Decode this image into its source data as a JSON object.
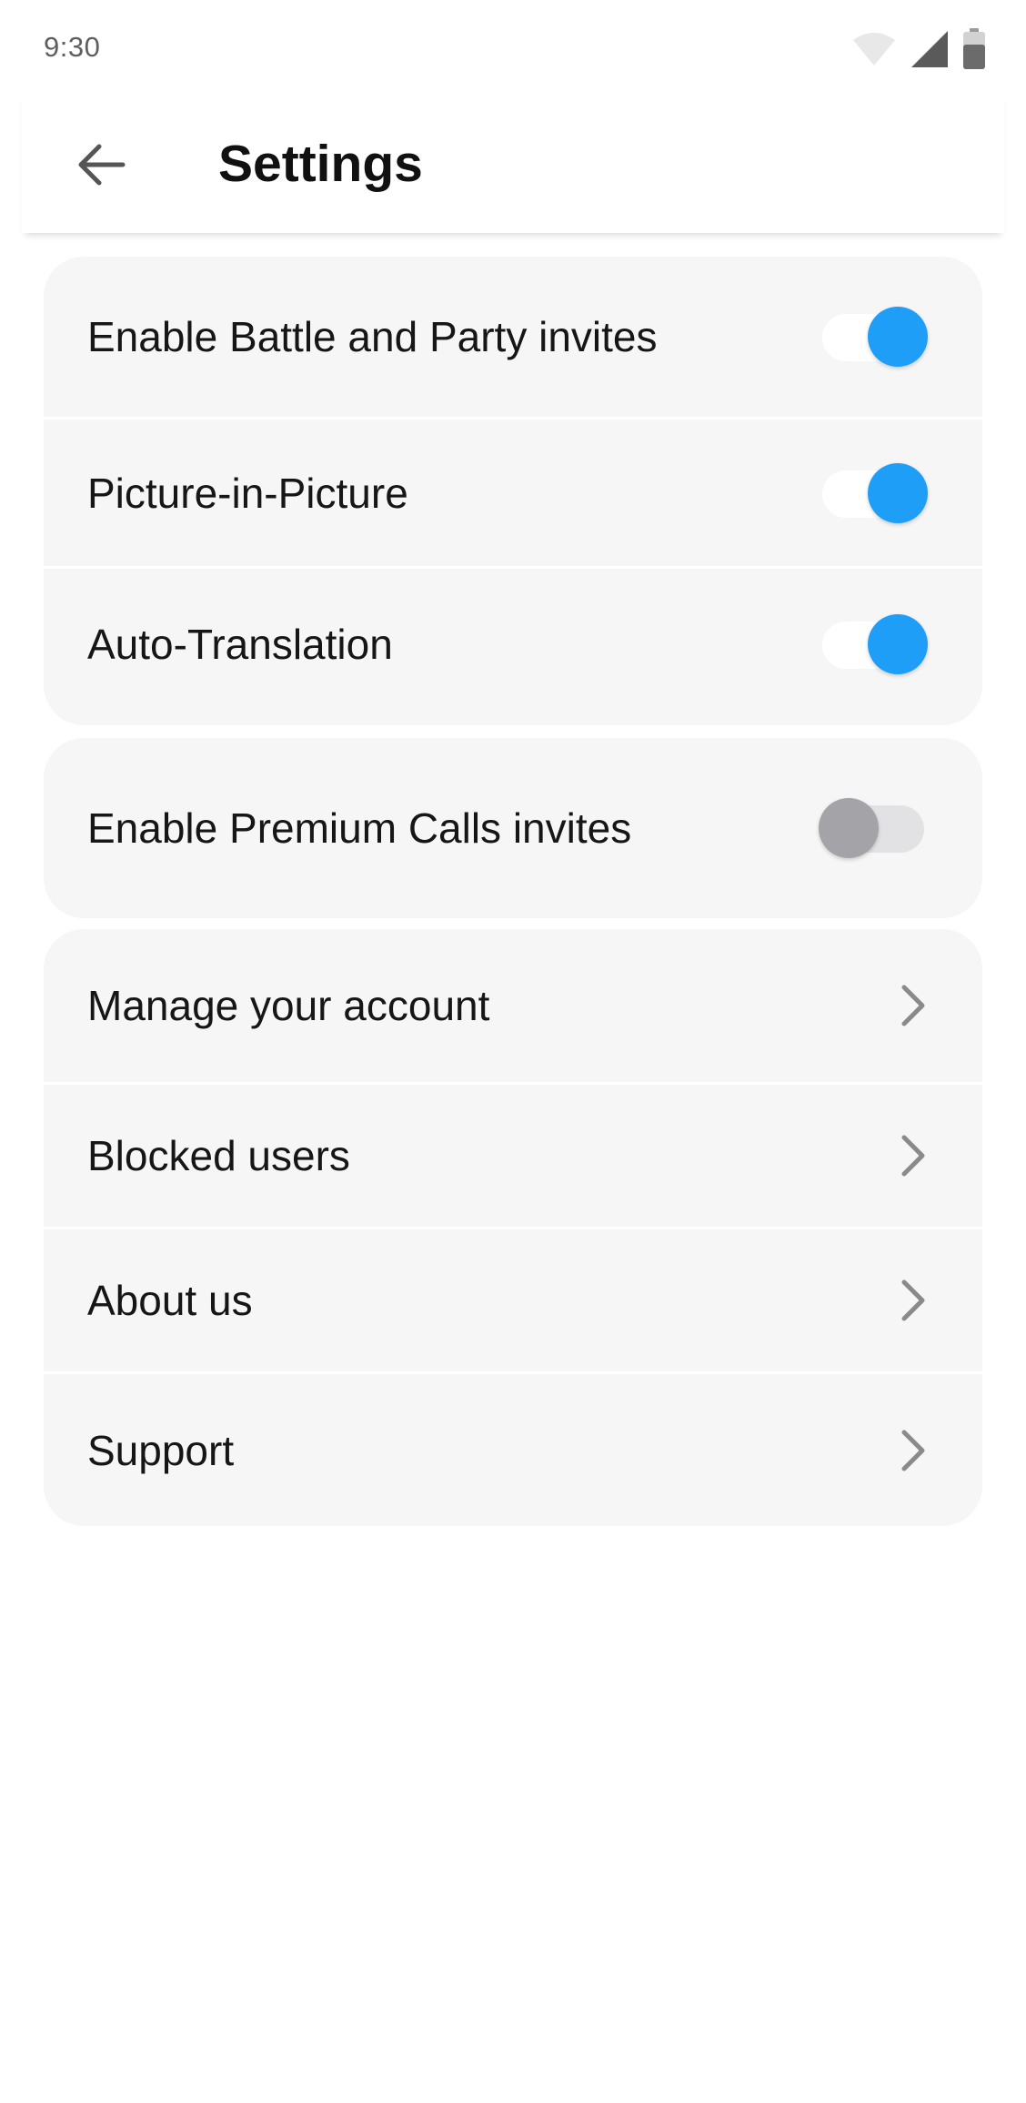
{
  "status_bar": {
    "time": "9:30"
  },
  "header": {
    "title": "Settings",
    "back_icon": "arrow-left-icon"
  },
  "toggle_section": {
    "items": [
      {
        "label": "Enable Battle and Party invites",
        "enabled": true
      },
      {
        "label": "Picture-in-Picture",
        "enabled": true
      },
      {
        "label": "Auto-Translation",
        "enabled": true
      }
    ]
  },
  "premium_section": {
    "items": [
      {
        "label": "Enable Premium Calls invites",
        "enabled": false
      }
    ]
  },
  "nav_section": {
    "items": [
      {
        "label": "Manage your account",
        "icon": "chevron-right-icon"
      },
      {
        "label": "Blocked users",
        "icon": "chevron-right-icon"
      },
      {
        "label": "About us",
        "icon": "chevron-right-icon"
      },
      {
        "label": "Support",
        "icon": "chevron-right-icon"
      }
    ]
  },
  "colors": {
    "toggle_on": "#1f9ef8",
    "toggle_off_knob": "#a4a4a8",
    "toggle_off_track": "#e2e2e4",
    "card_background": "#f6f6f6",
    "chevron": "#8a8a8a"
  }
}
